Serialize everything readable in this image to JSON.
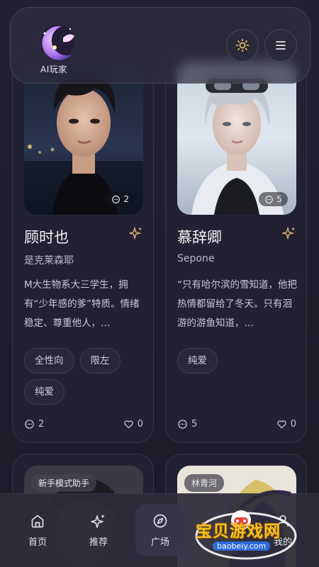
{
  "header": {
    "logo_text": "AI玩家",
    "theme_icon": "sun-icon",
    "menu_icon": "hamburger-menu-icon"
  },
  "cards": [
    {
      "photo_tag": "是克莱森耶",
      "chat_count": "2",
      "name": "顾时也",
      "author": "是克莱森耶",
      "description": "M大生物系大三学生，拥有“少年感的爹”特质。情绪稳定、尊重他人，…",
      "tags": [
        "全性向",
        "限左",
        "纯爱"
      ],
      "comments": "2",
      "likes": "0"
    },
    {
      "photo_tag": "Sepone",
      "chat_count": "5",
      "name": "慕辞卿",
      "author": "Sepone",
      "description": "“只有哈尔滨的雪知道，他把热情都留给了冬天。只有洄游的游鱼知道，…",
      "tags": [
        "纯爱"
      ],
      "comments": "5",
      "likes": "0"
    },
    {
      "photo_tag": "新手模式助手"
    },
    {
      "photo_tag": "林青河"
    }
  ],
  "nav": {
    "items": [
      {
        "label": "首页",
        "icon": "home-icon"
      },
      {
        "label": "推荐",
        "icon": "sparkle-icon"
      },
      {
        "label": "广场",
        "icon": "compass-icon"
      },
      {
        "label": "",
        "icon": ""
      },
      {
        "label": "我的",
        "icon": "user-icon"
      }
    ],
    "active": "广场"
  },
  "watermark": {
    "title": "宝贝游戏网",
    "url": "baobeiy.com"
  },
  "colors": {
    "background": "#1e1d2c",
    "card": "#222133",
    "accent_gold": "#d9b56a",
    "watermark_gold": "#f5c023"
  }
}
